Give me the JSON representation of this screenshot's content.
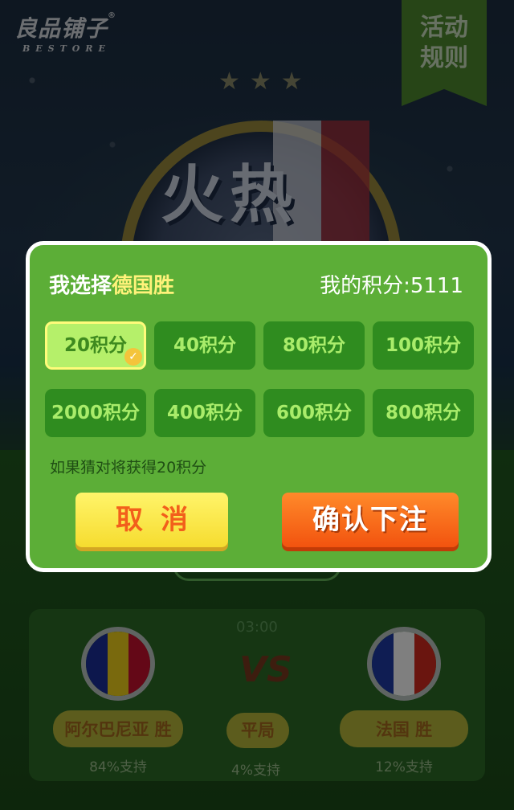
{
  "brand": {
    "name_cn": "良品铺子",
    "name_en": "BESTORE",
    "reg_mark": "®"
  },
  "rules_ribbon": {
    "line1": "活动",
    "line2": "规则"
  },
  "hero": {
    "title": "火热",
    "stars": "★★★"
  },
  "modal": {
    "choice_prefix": "我选择",
    "choice_team": "德国胜",
    "points_label": "我的积分:5111",
    "options": [
      {
        "label": "20积分",
        "selected": true
      },
      {
        "label": "40积分",
        "selected": false
      },
      {
        "label": "80积分",
        "selected": false
      },
      {
        "label": "100积分",
        "selected": false
      },
      {
        "label": "2000积分",
        "selected": false
      },
      {
        "label": "400积分",
        "selected": false
      },
      {
        "label": "600积分",
        "selected": false
      },
      {
        "label": "800积分",
        "selected": false
      }
    ],
    "hint": "如果猜对将获得20积分",
    "cancel_label": "取消",
    "confirm_label": "确认下注"
  },
  "match": {
    "time": "03:00",
    "vs": "VS",
    "home": {
      "label": "阿尔巴尼亚 胜",
      "support": "84%支持",
      "flag_colors": [
        "#1a2e9a",
        "#f3d31a",
        "#c8102e"
      ]
    },
    "draw": {
      "label": "平局",
      "support": "4%支持"
    },
    "away": {
      "label": "法国 胜",
      "support": "12%支持",
      "flag_colors": [
        "#1f3aa6",
        "#ffffff",
        "#d52b1e"
      ]
    }
  },
  "colors": {
    "modal_bg": "#5cae37",
    "option_bg": "#2f8c1f",
    "selected_bg": "#b5f06a",
    "highlight_yellow": "#fff27a",
    "confirm_orange": "#f2530f",
    "cancel_yellow": "#f6dc2f"
  }
}
